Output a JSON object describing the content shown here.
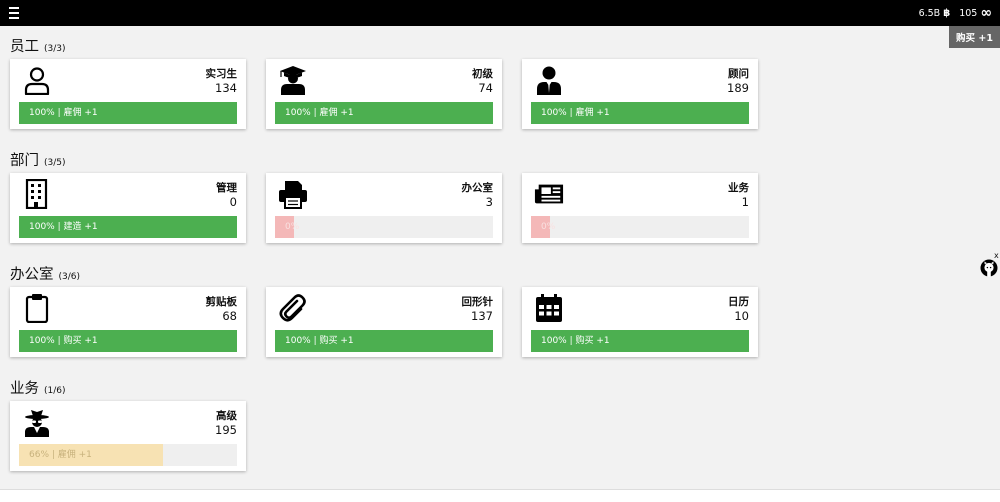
{
  "header": {
    "currency_value": "6.5B",
    "currency_icon": "bitcoin-icon",
    "secondary_value": "105",
    "secondary_icon": "infinity-icon"
  },
  "buy_toggle": {
    "label": "购买 +1"
  },
  "colors": {
    "topbar": "#000000",
    "progress_full": "#4caf50",
    "progress_empty": "#f4b8b8",
    "progress_partial": "#f7e2b3",
    "background": "#f2f2f2"
  },
  "sections": {
    "employees": {
      "title": "员工",
      "count": "(3/3)",
      "cards": [
        {
          "title": "实习生",
          "quantity": "134",
          "action": "100% | 雇佣 +1",
          "progress": 100,
          "icon": "person-outline-icon"
        },
        {
          "title": "初级",
          "quantity": "74",
          "action": "100% | 雇佣 +1",
          "progress": 100,
          "icon": "graduate-icon"
        },
        {
          "title": "顾问",
          "quantity": "189",
          "action": "100% | 雇佣 +1",
          "progress": 100,
          "icon": "businessman-icon"
        }
      ]
    },
    "departments": {
      "title": "部门",
      "count": "(3/5)",
      "cards": [
        {
          "title": "管理",
          "quantity": "0",
          "action": "100% | 建造 +1",
          "progress": 100,
          "icon": "building-icon"
        },
        {
          "title": "办公室",
          "quantity": "3",
          "action": "0%",
          "progress": 0,
          "icon": "printer-icon"
        },
        {
          "title": "业务",
          "quantity": "1",
          "action": "0%",
          "progress": 0,
          "icon": "newspaper-icon"
        }
      ]
    },
    "office": {
      "title": "办公室",
      "count": "(3/6)",
      "cards": [
        {
          "title": "剪贴板",
          "quantity": "68",
          "action": "100% | 购买 +1",
          "progress": 100,
          "icon": "clipboard-icon"
        },
        {
          "title": "回形针",
          "quantity": "137",
          "action": "100% | 购买 +1",
          "progress": 100,
          "icon": "paperclip-icon"
        },
        {
          "title": "日历",
          "quantity": "10",
          "action": "100% | 购买 +1",
          "progress": 100,
          "icon": "calendar-icon"
        }
      ]
    },
    "business": {
      "title": "业务",
      "count": "(1/6)",
      "cards": [
        {
          "title": "高级",
          "quantity": "195",
          "action": "66% | 雇佣 +1",
          "progress": 66,
          "icon": "spy-icon"
        }
      ]
    }
  },
  "side_widget": {
    "close_label": "x",
    "icon": "github-icon"
  }
}
